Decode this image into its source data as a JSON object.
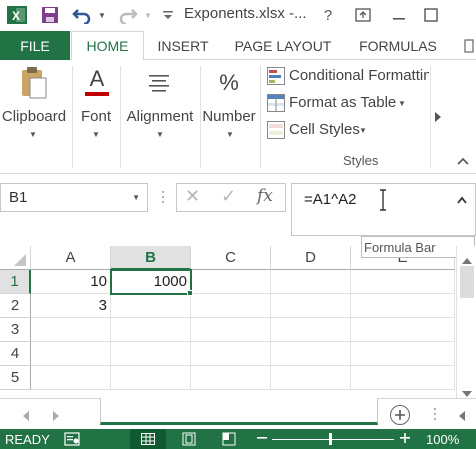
{
  "window": {
    "title": "Exponents.xlsx -..."
  },
  "quick_access": {
    "app_icon": "excel-logo-icon",
    "save_icon": "save-icon",
    "undo_icon": "undo-icon",
    "redo_icon": "redo-icon"
  },
  "window_controls": {
    "help": "?",
    "ribbon_display_icon": "ribbon-display-icon",
    "minimize_icon": "minimize-icon",
    "restore_icon": "restore-icon"
  },
  "tabs": {
    "file": "FILE",
    "home": "HOME",
    "insert": "INSERT",
    "page_layout": "PAGE LAYOUT",
    "formulas": "FORMULAS"
  },
  "ribbon": {
    "clipboard": "Clipboard",
    "font": "Font",
    "font_glyph": "A",
    "alignment": "Alignment",
    "number": "Number",
    "number_glyph": "%",
    "conditional_formatting": "Conditional Formattin",
    "format_as_table": "Format as Table",
    "cell_styles": "Cell Styles",
    "styles_group": "Styles"
  },
  "formula_bar": {
    "name_box": "B1",
    "cancel_glyph": "✕",
    "enter_glyph": "✓",
    "fx": "fx",
    "formula": "=A1^A2",
    "tooltip": "Formula Bar"
  },
  "grid": {
    "columns": [
      "A",
      "B",
      "C",
      "D",
      "E"
    ],
    "rows": [
      "1",
      "2",
      "3",
      "4",
      "5"
    ],
    "cells": {
      "A1": "10",
      "B1": "1000",
      "A2": "3"
    },
    "selected_cell": "B1",
    "selection_color": "#217346"
  },
  "status_bar": {
    "mode": "READY",
    "zoom": "100%"
  },
  "colors": {
    "accent": "#217346"
  }
}
